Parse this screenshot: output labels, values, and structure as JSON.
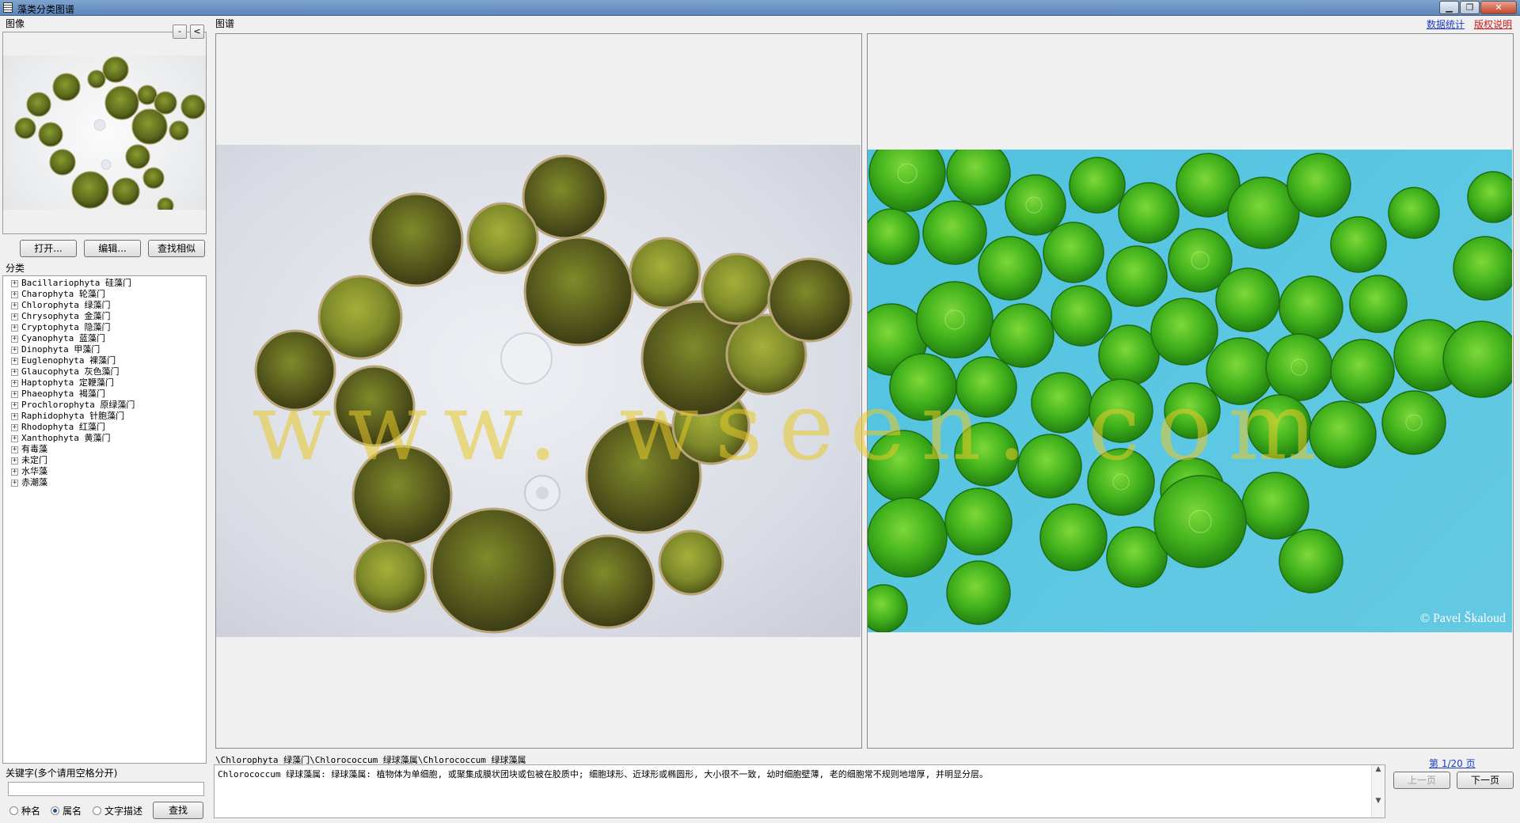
{
  "window": {
    "title": "藻类分类图谱",
    "min_label": "▁",
    "max_label": "❐",
    "close_label": "✕"
  },
  "top_links": {
    "stats": "数据统计",
    "copyright": "版权说明"
  },
  "left": {
    "image_label": "图像",
    "mini_btn_1": "-",
    "mini_btn_2": "<",
    "buttons": {
      "open": "打开...",
      "edit": "编辑...",
      "find_similar": "查找相似"
    },
    "category_label": "分类",
    "tree": [
      "Bacillariophyta 硅藻门",
      "Charophyta 轮藻门",
      "Chlorophyta 绿藻门",
      "Chrysophyta 金藻门",
      "Cryptophyta 隐藻门",
      "Cyanophyta 蓝藻门",
      "Dinophyta 甲藻门",
      "Euglenophyta 裸藻门",
      "Glaucophyta 灰色藻门",
      "Haptophyta 定鞭藻门",
      "Phaeophyta 褐藻门",
      "Prochlorophyta 原绿藻门",
      "Raphidophyta 针胞藻门",
      "Rhodophyta 红藻门",
      "Xanthophyta 黄藻门",
      "有毒藻",
      "未定门",
      "水华藻",
      "赤潮藻"
    ],
    "keyword_label": "关键字(多个请用空格分开)",
    "radios": [
      {
        "label": "种名",
        "checked": false
      },
      {
        "label": "属名",
        "checked": true
      },
      {
        "label": "文字描述",
        "checked": false
      }
    ],
    "search_button": "查找"
  },
  "main": {
    "atlas_label": "图谱",
    "watermark": "www. wseen. com",
    "credit": "© Pavel Škaloud",
    "path": "\\Chlorophyta 绿藻门\\Chlorococcum 绿球藻属\\Chlorococcum 绿球藻属",
    "description": "Chlorococcum 绿球藻属: 绿球藻属: 植物体为单细胞, 或聚集成膜状团块或包被在胶质中; 细胞球形、近球形或椭圆形, 大小很不一致, 幼时细胞壁薄, 老的细胞常不规则地增厚, 并明显分层。",
    "page_info": "第 1/20 页",
    "prev": "上一页",
    "next": "下一页"
  }
}
